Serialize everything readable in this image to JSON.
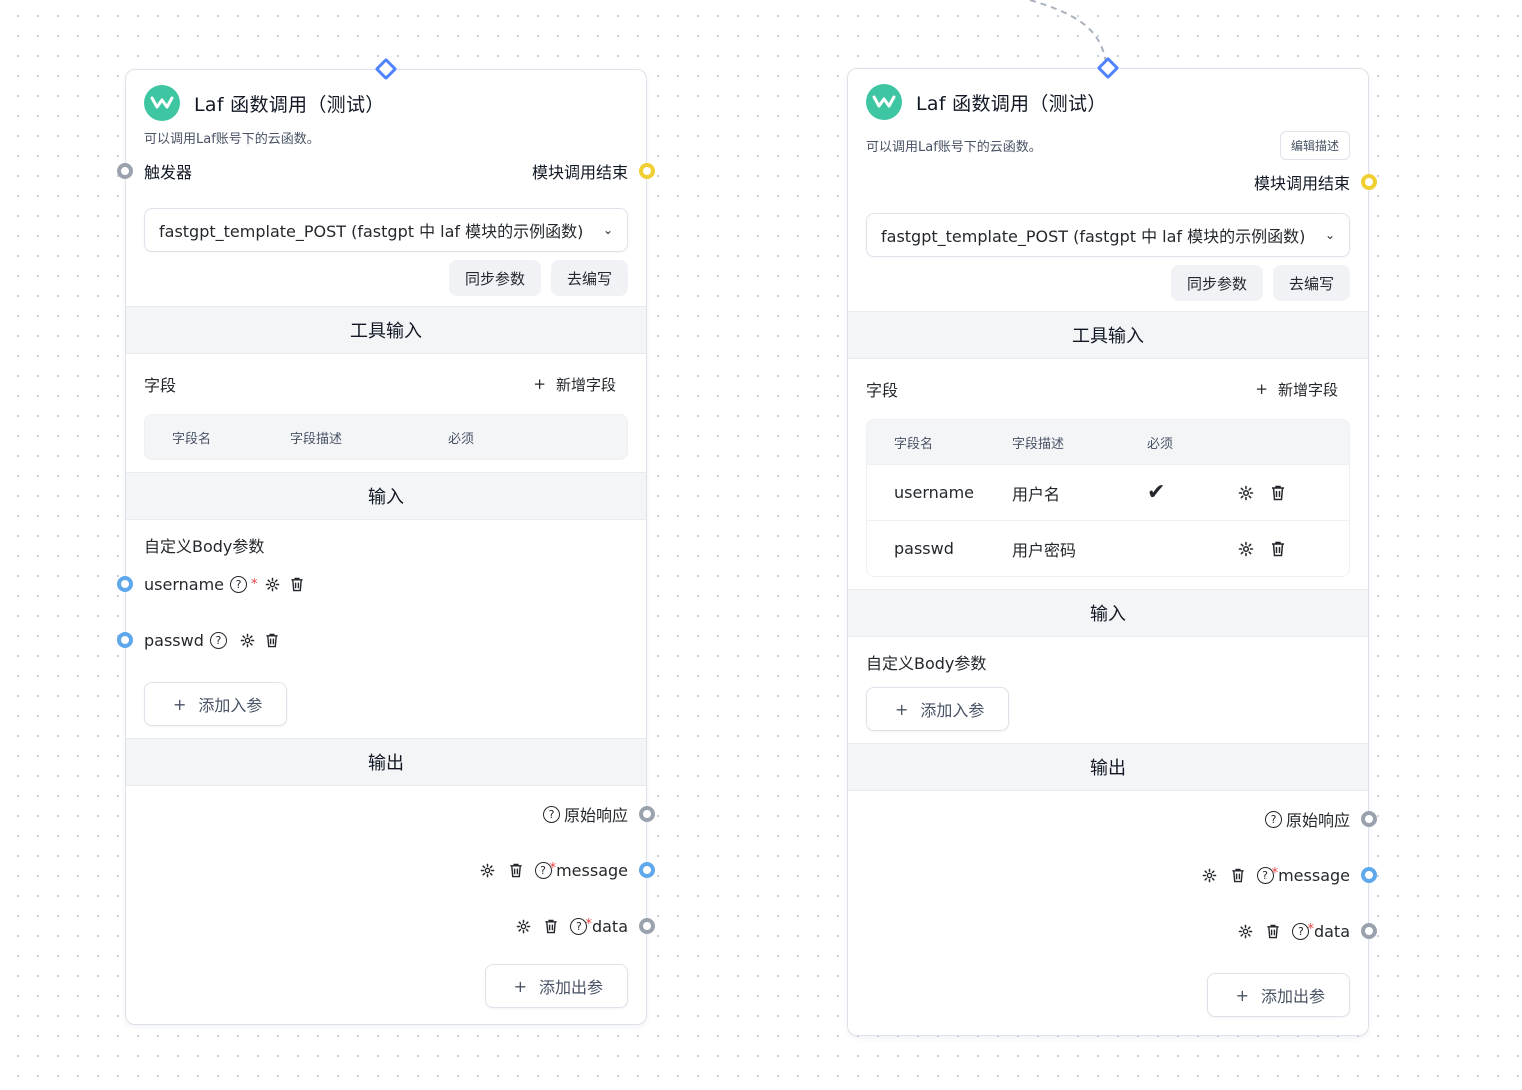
{
  "colors": {
    "accent": "#4e83fd",
    "logo": "#3ec6a2",
    "handle_gray": "#9aa2ae",
    "handle_blue": "#5fa8ec",
    "handle_yellow": "#f0cf33",
    "required": "#e53e3e"
  },
  "nodes": [
    {
      "title": "Laf 函数调用（测试）",
      "intro": "可以调用Laf账号下的云函数。",
      "trigger_label": "触发器",
      "finish_label": "模块调用结束",
      "function_select": "fastgpt_template_POST (fastgpt 中 laf 模块的示例函数)",
      "sync_button": "同步参数",
      "edit_button": "去编写",
      "tool_input_title": "工具输入",
      "fields_label": "字段",
      "add_field_label": "新增字段",
      "table_headers": [
        "字段名",
        "字段描述",
        "必须"
      ],
      "input_title": "输入",
      "body_params_title": "自定义Body参数",
      "inputs": [
        {
          "name": "username"
        },
        {
          "name": "passwd"
        }
      ],
      "add_input_label": "添加入参",
      "output_title": "输出",
      "outputs": [
        {
          "name": "原始响应"
        },
        {
          "name": "message"
        },
        {
          "name": "data"
        }
      ],
      "add_output_label": "添加出参"
    },
    {
      "title": "Laf 函数调用（测试）",
      "intro": "可以调用Laf账号下的云函数。",
      "edit_intro_button": "编辑描述",
      "finish_label": "模块调用结束",
      "function_select": "fastgpt_template_POST (fastgpt 中 laf 模块的示例函数)",
      "sync_button": "同步参数",
      "edit_button": "去编写",
      "tool_input_title": "工具输入",
      "fields_label": "字段",
      "add_field_label": "新增字段",
      "table_headers": [
        "字段名",
        "字段描述",
        "必须"
      ],
      "table_rows": [
        {
          "name": "username",
          "desc": "用户名",
          "required": "✔"
        },
        {
          "name": "passwd",
          "desc": "用户密码",
          "required": ""
        }
      ],
      "input_title": "输入",
      "body_params_title": "自定义Body参数",
      "add_input_label": "添加入参",
      "output_title": "输出",
      "outputs": [
        {
          "name": "原始响应"
        },
        {
          "name": "message"
        },
        {
          "name": "data"
        }
      ],
      "add_output_label": "添加出参"
    }
  ]
}
